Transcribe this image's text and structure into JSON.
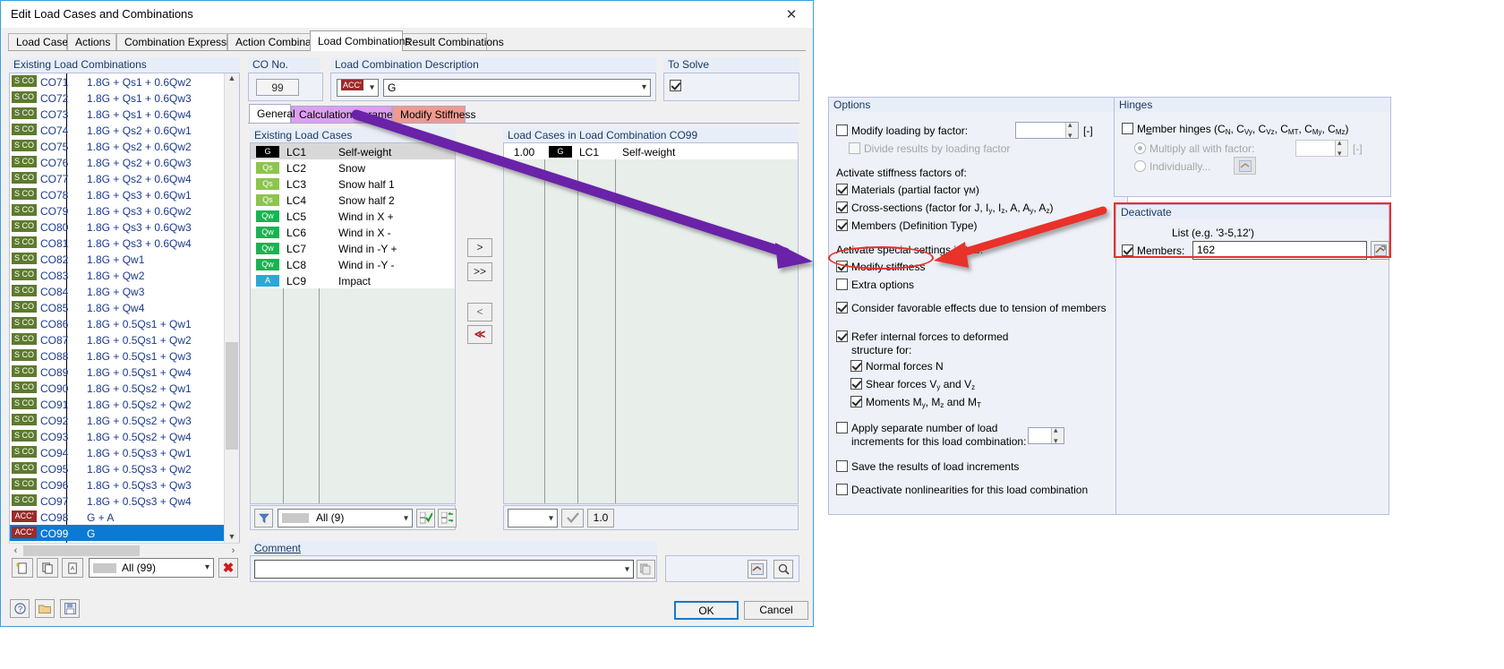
{
  "window": {
    "title": "Edit Load Cases and Combinations",
    "close_icon": "close-icon"
  },
  "tabs": [
    {
      "label": "Load Cases",
      "active": false
    },
    {
      "label": "Actions",
      "active": false
    },
    {
      "label": "Combination Expressions",
      "active": false
    },
    {
      "label": "Action Combinations",
      "active": false
    },
    {
      "label": "Load Combinations",
      "active": true
    },
    {
      "label": "Result Combinations",
      "active": false
    }
  ],
  "left": {
    "group_title": "Existing Load Combinations",
    "rows": [
      {
        "badge": "S CO",
        "badge_color": "#5d7a2e",
        "co": "CO71",
        "desc": "1.8G + Qs1 + 0.6Qw2"
      },
      {
        "badge": "S CO",
        "badge_color": "#5d7a2e",
        "co": "CO72",
        "desc": "1.8G + Qs1 + 0.6Qw3"
      },
      {
        "badge": "S CO",
        "badge_color": "#5d7a2e",
        "co": "CO73",
        "desc": "1.8G + Qs1 + 0.6Qw4"
      },
      {
        "badge": "S CO",
        "badge_color": "#5d7a2e",
        "co": "CO74",
        "desc": "1.8G + Qs2 + 0.6Qw1"
      },
      {
        "badge": "S CO",
        "badge_color": "#5d7a2e",
        "co": "CO75",
        "desc": "1.8G + Qs2 + 0.6Qw2"
      },
      {
        "badge": "S CO",
        "badge_color": "#5d7a2e",
        "co": "CO76",
        "desc": "1.8G + Qs2 + 0.6Qw3"
      },
      {
        "badge": "S CO",
        "badge_color": "#5d7a2e",
        "co": "CO77",
        "desc": "1.8G + Qs2 + 0.6Qw4"
      },
      {
        "badge": "S CO",
        "badge_color": "#5d7a2e",
        "co": "CO78",
        "desc": "1.8G + Qs3 + 0.6Qw1"
      },
      {
        "badge": "S CO",
        "badge_color": "#5d7a2e",
        "co": "CO79",
        "desc": "1.8G + Qs3 + 0.6Qw2"
      },
      {
        "badge": "S CO",
        "badge_color": "#5d7a2e",
        "co": "CO80",
        "desc": "1.8G + Qs3 + 0.6Qw3"
      },
      {
        "badge": "S CO",
        "badge_color": "#5d7a2e",
        "co": "CO81",
        "desc": "1.8G + Qs3 + 0.6Qw4"
      },
      {
        "badge": "S CO",
        "badge_color": "#5d7a2e",
        "co": "CO82",
        "desc": "1.8G + Qw1"
      },
      {
        "badge": "S CO",
        "badge_color": "#5d7a2e",
        "co": "CO83",
        "desc": "1.8G + Qw2"
      },
      {
        "badge": "S CO",
        "badge_color": "#5d7a2e",
        "co": "CO84",
        "desc": "1.8G + Qw3"
      },
      {
        "badge": "S CO",
        "badge_color": "#5d7a2e",
        "co": "CO85",
        "desc": "1.8G + Qw4"
      },
      {
        "badge": "S CO",
        "badge_color": "#5d7a2e",
        "co": "CO86",
        "desc": "1.8G + 0.5Qs1 + Qw1"
      },
      {
        "badge": "S CO",
        "badge_color": "#5d7a2e",
        "co": "CO87",
        "desc": "1.8G + 0.5Qs1 + Qw2"
      },
      {
        "badge": "S CO",
        "badge_color": "#5d7a2e",
        "co": "CO88",
        "desc": "1.8G + 0.5Qs1 + Qw3"
      },
      {
        "badge": "S CO",
        "badge_color": "#5d7a2e",
        "co": "CO89",
        "desc": "1.8G + 0.5Qs1 + Qw4"
      },
      {
        "badge": "S CO",
        "badge_color": "#5d7a2e",
        "co": "CO90",
        "desc": "1.8G + 0.5Qs2 + Qw1"
      },
      {
        "badge": "S CO",
        "badge_color": "#5d7a2e",
        "co": "CO91",
        "desc": "1.8G + 0.5Qs2 + Qw2"
      },
      {
        "badge": "S CO",
        "badge_color": "#5d7a2e",
        "co": "CO92",
        "desc": "1.8G + 0.5Qs2 + Qw3"
      },
      {
        "badge": "S CO",
        "badge_color": "#5d7a2e",
        "co": "CO93",
        "desc": "1.8G + 0.5Qs2 + Qw4"
      },
      {
        "badge": "S CO",
        "badge_color": "#5d7a2e",
        "co": "CO94",
        "desc": "1.8G + 0.5Qs3 + Qw1"
      },
      {
        "badge": "S CO",
        "badge_color": "#5d7a2e",
        "co": "CO95",
        "desc": "1.8G + 0.5Qs3 + Qw2"
      },
      {
        "badge": "S CO",
        "badge_color": "#5d7a2e",
        "co": "CO96",
        "desc": "1.8G + 0.5Qs3 + Qw3"
      },
      {
        "badge": "S CO",
        "badge_color": "#5d7a2e",
        "co": "CO97",
        "desc": "1.8G + 0.5Qs3 + Qw4"
      },
      {
        "badge": "ACC'",
        "badge_color": "#9c2a2a",
        "co": "CO98",
        "desc": "G + A"
      },
      {
        "badge": "ACC'",
        "badge_color": "#9c2a2a",
        "co": "CO99",
        "desc": "G",
        "selected": true
      }
    ],
    "toolbar": {
      "new_icon": "new-combination-icon",
      "copy_icon": "copy-combination-icon",
      "rename_icon": "rename-combination-icon",
      "filter_value": "All (99)",
      "delete_icon": "delete-red-x-icon"
    }
  },
  "co_no": {
    "label": "CO No.",
    "value": "99"
  },
  "description": {
    "label": "Load Combination Description",
    "badge": "ACC'",
    "badge_color": "#9c2a2a",
    "value": "G"
  },
  "to_solve": {
    "label": "To Solve",
    "checked": true
  },
  "inner_tabs": [
    {
      "label": "General",
      "active": true,
      "color": "#ffffff"
    },
    {
      "label": "Calculation Parameters",
      "active": false,
      "color": "#dd9ff0"
    },
    {
      "label": "Modify Stiffness",
      "active": false,
      "color": "#f09a90"
    }
  ],
  "existing_load_cases": {
    "group_title": "Existing Load Cases",
    "rows": [
      {
        "badge": "G",
        "badge_color": "#000000",
        "id": "LC1",
        "name": "Self-weight",
        "selected": true
      },
      {
        "badge": "Qs",
        "badge_color": "#8dc44e",
        "id": "LC2",
        "name": "Snow"
      },
      {
        "badge": "Qs",
        "badge_color": "#8dc44e",
        "id": "LC3",
        "name": "Snow half 1"
      },
      {
        "badge": "Qs",
        "badge_color": "#8dc44e",
        "id": "LC4",
        "name": "Snow half 2"
      },
      {
        "badge": "Qw",
        "badge_color": "#17b451",
        "id": "LC5",
        "name": "Wind in X +"
      },
      {
        "badge": "Qw",
        "badge_color": "#17b451",
        "id": "LC6",
        "name": "Wind in X -"
      },
      {
        "badge": "Qw",
        "badge_color": "#17b451",
        "id": "LC7",
        "name": "Wind in -Y +"
      },
      {
        "badge": "Qw",
        "badge_color": "#17b451",
        "id": "LC8",
        "name": "Wind in -Y -"
      },
      {
        "badge": "A",
        "badge_color": "#2ba8d8",
        "id": "LC9",
        "name": "Impact"
      }
    ],
    "footer": {
      "filter_icon": "filter-funnel-icon",
      "filter_value": "All (9)",
      "select_all_icon": "select-all-icon",
      "invert_selection_icon": "invert-selection-icon"
    }
  },
  "transfer_buttons": [
    {
      "name": "move-right-button",
      "glyph": ">"
    },
    {
      "name": "move-all-right-button",
      "glyph": ">>"
    },
    {
      "name": "move-left-button",
      "glyph": "<"
    },
    {
      "name": "move-all-left-button",
      "glyph": "≪"
    }
  ],
  "combination_cases": {
    "group_title": "Load Cases in Load Combination CO99",
    "rows": [
      {
        "factor": "1.00",
        "badge": "G",
        "badge_color": "#000000",
        "id": "LC1",
        "name": "Self-weight"
      }
    ],
    "footer": {
      "combo_value": "",
      "apply_icon": "apply-check-icon",
      "factor_value": "1.0"
    }
  },
  "comment": {
    "label": "Comment",
    "value": "",
    "pick_icon": "pick-comment-icon",
    "right_icon_1": "set-default-icon",
    "right_icon_2": "zoom-details-icon"
  },
  "options": {
    "title": "Options",
    "modify_loading": {
      "label": "Modify loading by factor:",
      "checked": false,
      "value": "",
      "unit": "[-]"
    },
    "divide_results": {
      "label": "Divide results by loading factor",
      "checked": false,
      "disabled": true
    },
    "stiffness_header": "Activate stiffness factors of:",
    "materials": {
      "label": "Materials (partial factor γM)",
      "checked": true
    },
    "cross_sections": {
      "label": "Cross-sections (factor for J, Iy, Iz, A, Ay, Az)",
      "checked": true
    },
    "members": {
      "label": "Members (Definition Type)",
      "checked": true
    },
    "special_header": "Activate special settings in tab:",
    "modify_stiffness": {
      "label": "Modify stiffness",
      "checked": true
    },
    "extra_options": {
      "label": "Extra options",
      "checked": false
    },
    "favorable": {
      "label": "Consider favorable effects due to tension of members",
      "checked": true
    },
    "refer_internal": {
      "label_1": "Refer internal forces to deformed",
      "label_2": "structure for:",
      "checked": true
    },
    "normal_forces": {
      "label": "Normal forces N",
      "checked": true
    },
    "shear_forces": {
      "label": "Shear forces Vy and Vz",
      "checked": true
    },
    "moments": {
      "label": "Moments My, Mz and MT",
      "checked": true
    },
    "apply_increments": {
      "label_1": "Apply separate number of load",
      "label_2": "increments for this load combination:",
      "checked": false,
      "value": ""
    },
    "save_increments": {
      "label": "Save the results of load increments",
      "checked": false
    },
    "deactivate_nonlin": {
      "label": "Deactivate nonlinearities for this load combination",
      "checked": false
    }
  },
  "hinges": {
    "title": "Hinges",
    "member_hinges": {
      "label": "Member hinges (CN, CVy, CVz, CMT, CMy, CMz)",
      "checked": false
    },
    "multiply": {
      "label": "Multiply all with factor:",
      "selected": true,
      "disabled": true,
      "value": "",
      "unit": "[-]"
    },
    "individually": {
      "label": "Individually...",
      "selected": false,
      "disabled": true,
      "icon": "edit-table-icon"
    }
  },
  "deactivate": {
    "title": "Deactivate",
    "list_label": "List (e.g. '3-5,12')",
    "members": {
      "label": "Members:",
      "checked": true,
      "value": "162",
      "pick_icon": "pick-members-icon"
    }
  },
  "footer": {
    "help_icon": "help-icon",
    "open_icon": "open-icon",
    "save_icon": "save-icon",
    "ok_label": "OK",
    "cancel_label": "Cancel"
  },
  "annotations": {
    "purple_arrow": "purple-arrow-annotation",
    "red_arrow": "red-arrow-annotation",
    "red_ellipse": "red-ellipse-highlight",
    "red_rect": "red-rect-highlight"
  }
}
